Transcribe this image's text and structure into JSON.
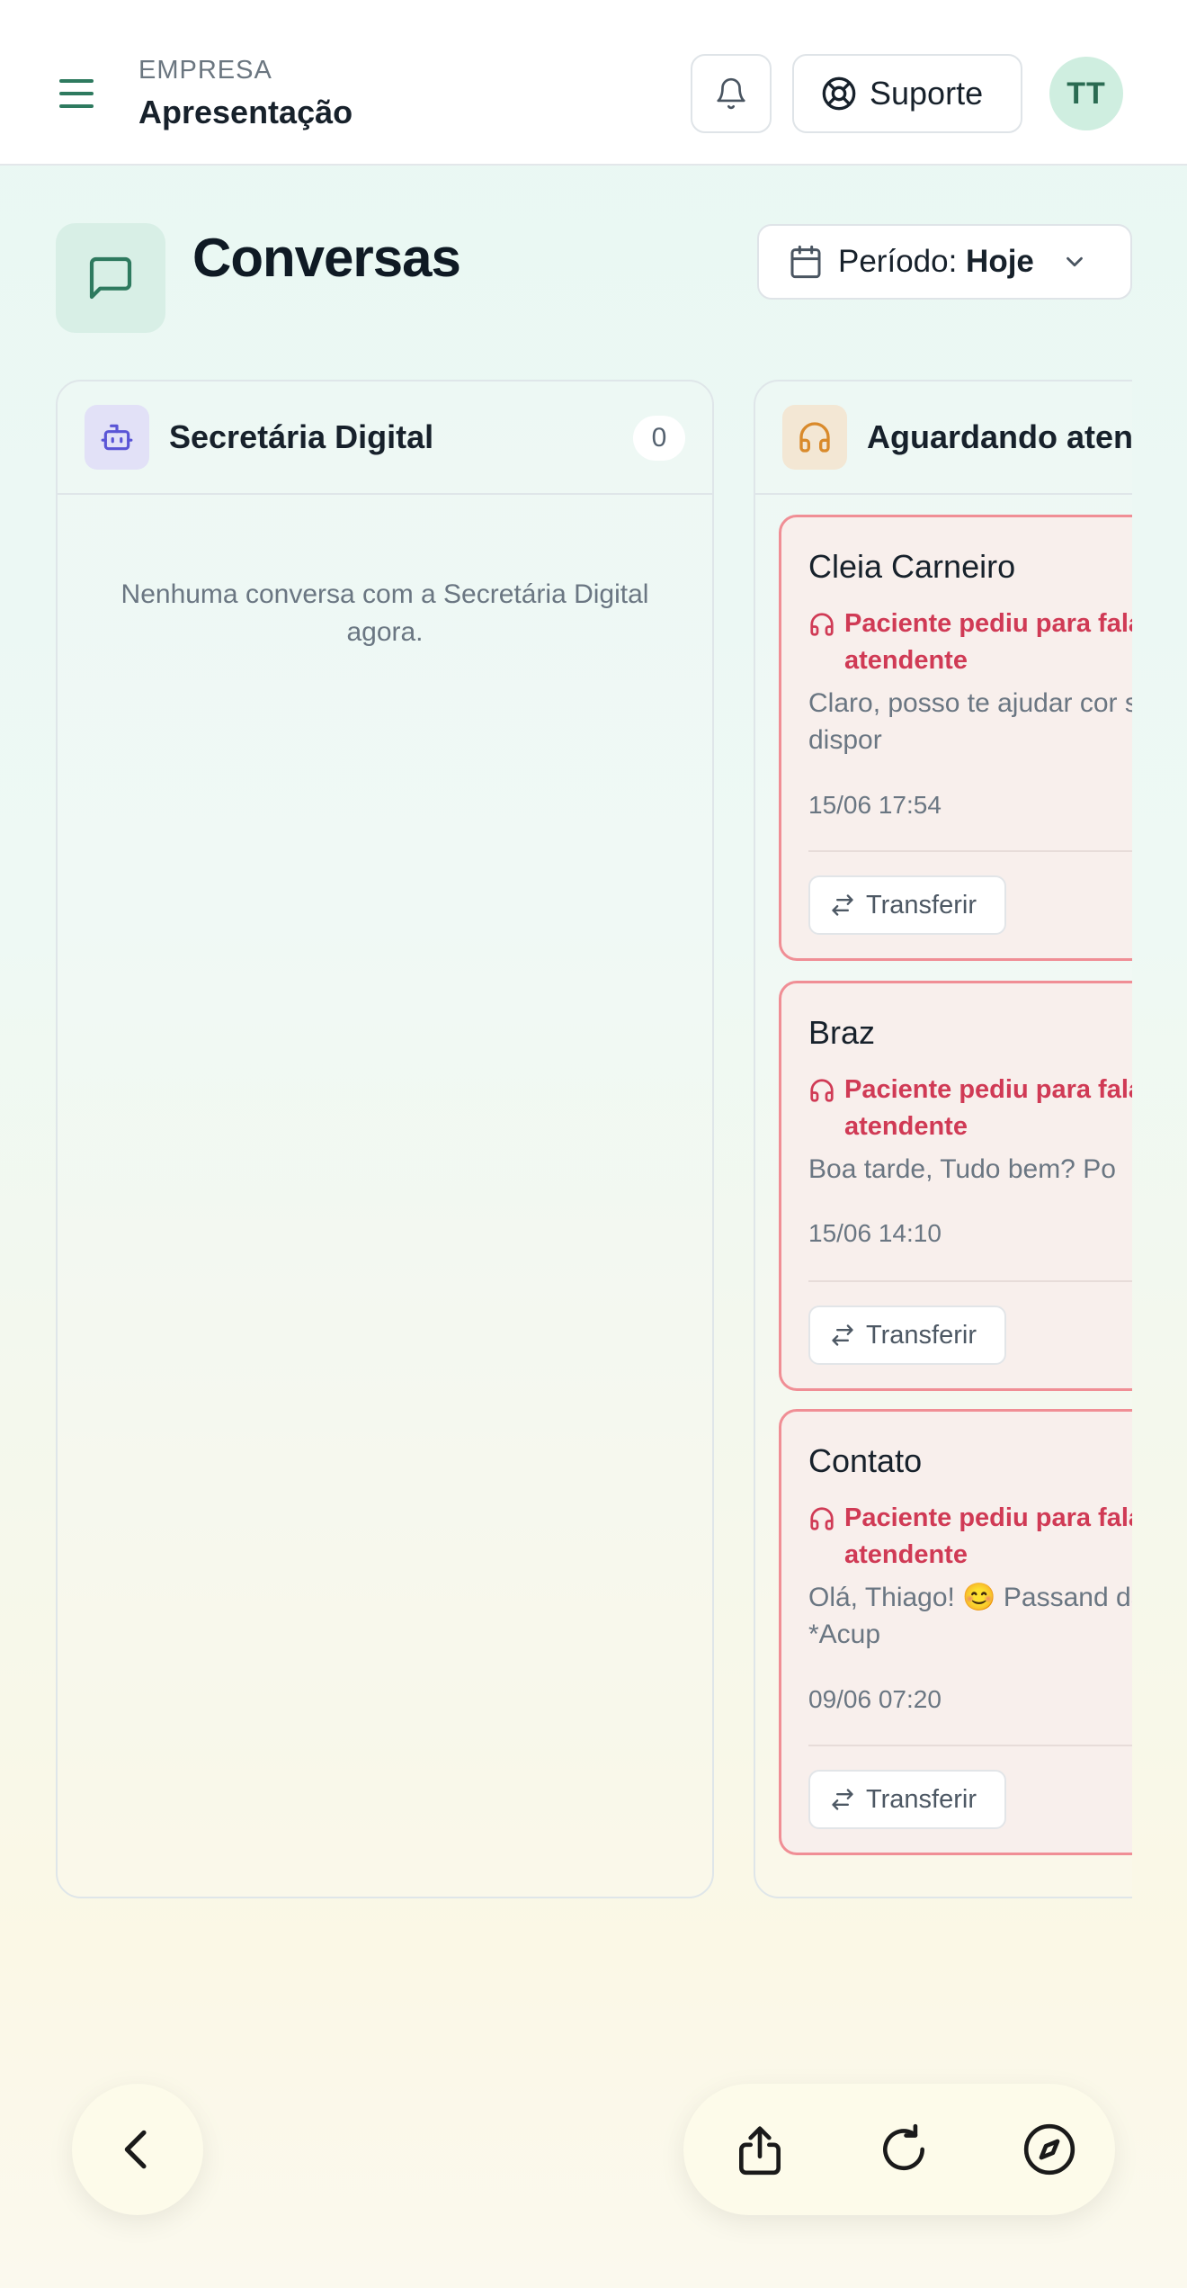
{
  "header": {
    "company_label": "EMPRESA",
    "company_name": "Apresentação",
    "support_label": "Suporte",
    "avatar_initials": "TT"
  },
  "page": {
    "title": "Conversas",
    "period_label": "Período:",
    "period_value": "Hoje"
  },
  "columns": [
    {
      "title": "Secretária Digital",
      "count": "0",
      "empty_message": "Nenhuma conversa com a Secretária Digital agora.",
      "icon": "robot-icon",
      "accent": "#5a55d6"
    },
    {
      "title": "Aguardando aten",
      "icon": "headset-icon",
      "accent": "#d98a2b",
      "cards": [
        {
          "name": "Cleia Carneiro",
          "alert": "Paciente pediu para fala atendente",
          "message": "Claro, posso te ajudar cor seu nome ? Estaria dispor",
          "time": "15/06 17:54",
          "transfer_label": "Transferir"
        },
        {
          "name": "Braz",
          "alert": "Paciente pediu para fala atendente",
          "message": "Boa tarde, Tudo bem? Po",
          "time": "15/06 14:10",
          "transfer_label": "Transferir"
        },
        {
          "name": "Contato",
          "alert": "Paciente pediu para fala atendente",
          "message": "Olá, Thiago! 😊  Passand da sua consulta de *Acup",
          "time": "09/06 07:20",
          "transfer_label": "Transferir"
        }
      ]
    }
  ],
  "browser_bar": {
    "icons": [
      "back-icon",
      "share-icon",
      "reload-icon",
      "compass-icon"
    ]
  },
  "colors": {
    "brand": "#2e7a5f",
    "alert": "#d03a55",
    "card_border": "#f08e95"
  }
}
